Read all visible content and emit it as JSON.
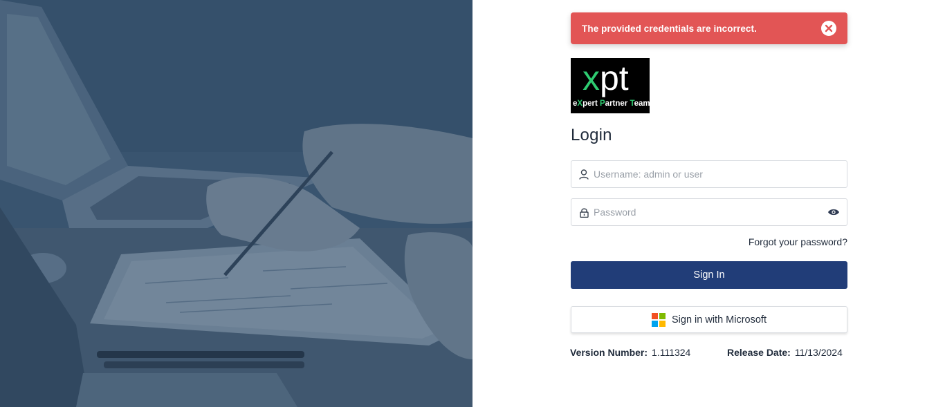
{
  "alert": {
    "message": "The provided credentials are incorrect.",
    "close_icon": "close-circle-icon",
    "color": "#e25555"
  },
  "logo": {
    "mark_x": "x",
    "mark_rest": "pt",
    "tag_1": "e",
    "tag_2": "X",
    "tag_3": "pert ",
    "tag_4": "P",
    "tag_5": "artner ",
    "tag_6": "T",
    "tag_7": "eam"
  },
  "login": {
    "title": "Login",
    "username_placeholder": "Username: admin or user",
    "password_placeholder": "Password",
    "forgot_label": "Forgot your password?",
    "sign_in_label": "Sign In",
    "microsoft_label": "Sign in with Microsoft",
    "user_icon": "user-icon",
    "lock_icon": "lock-icon",
    "eye_icon": "eye-icon",
    "accent_color": "#213d78"
  },
  "footer": {
    "version_label": "Version Number:",
    "version_value": "1.111324",
    "release_label": "Release Date:",
    "release_value": "11/13/2024"
  }
}
